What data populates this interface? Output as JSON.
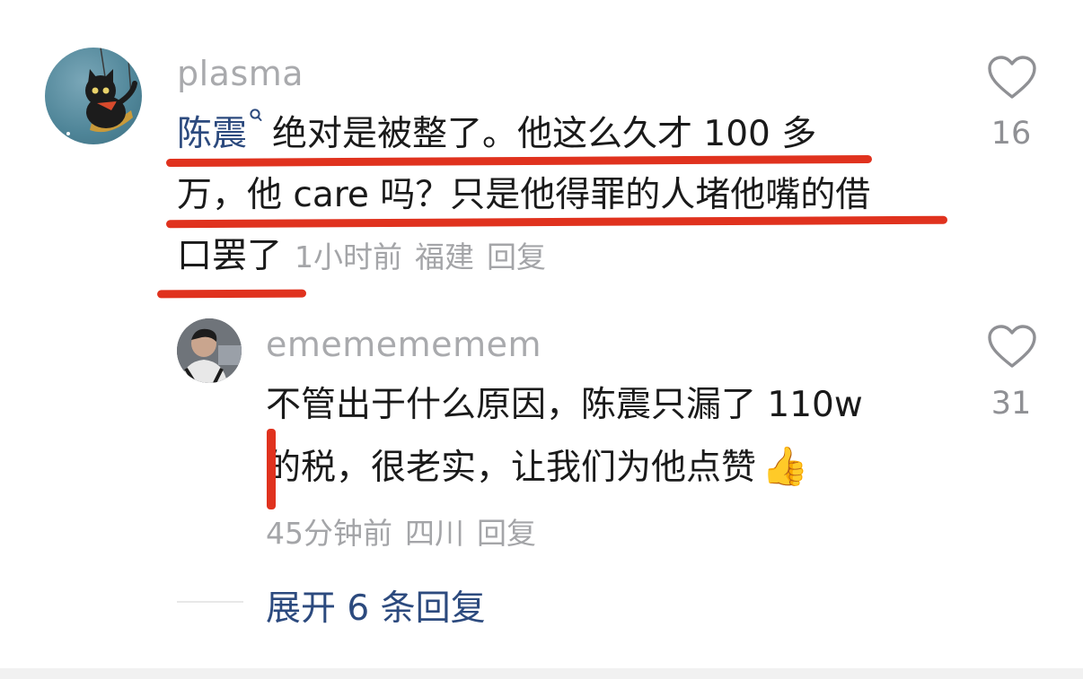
{
  "comments": [
    {
      "username": "plasma",
      "mention": "陈震",
      "text_line1": "绝对是被整了。他这么久才 100 多",
      "text_line2": "万，他 care 吗？只是他得罪的人堵他嘴的借",
      "text_line3": "口罢了",
      "time": "1小时前",
      "location": "福建",
      "reply_label": "回复",
      "likes": "16"
    },
    {
      "username": "ememememem",
      "text_line1": "不管出于什么原因，陈震只漏了 110w",
      "text_line2": "的税，很老实，让我们为他点赞",
      "emoji": "👍",
      "time": "45分钟前",
      "location": "四川",
      "reply_label": "回复",
      "likes": "31"
    }
  ],
  "expand_replies_label": "展开 6 条回复",
  "icons": {
    "like": "heart-outline-icon",
    "search_mention": "search-icon"
  },
  "colors": {
    "username": "#a9aaad",
    "mention": "#2c4a7e",
    "annotation": "#e0321e",
    "meta": "#a4a5a8"
  }
}
